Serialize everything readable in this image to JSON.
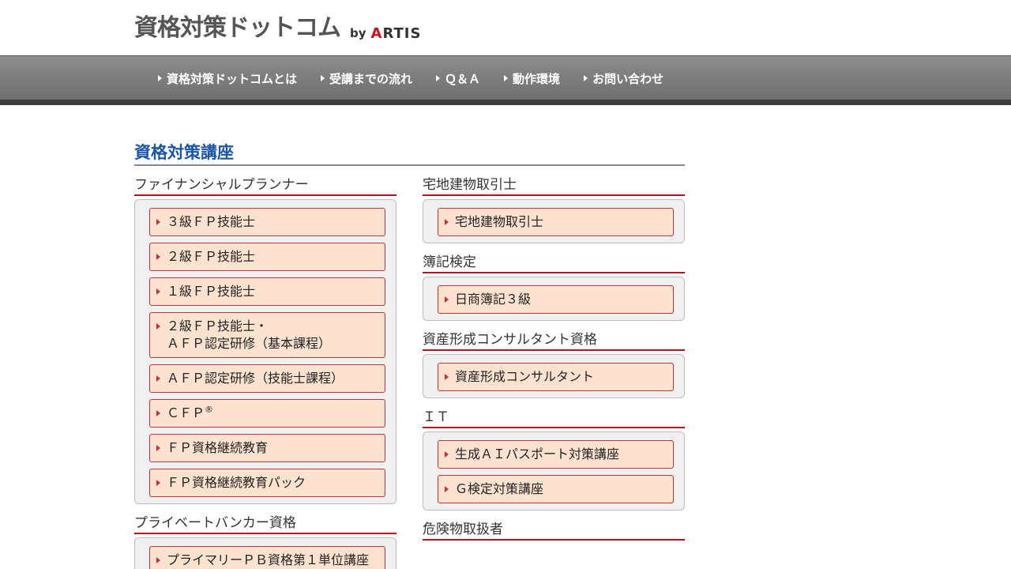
{
  "header": {
    "logo_main": "資格対策ドットコム",
    "logo_by": "by",
    "logo_brand_a": "A",
    "logo_brand_rest": "RTIS"
  },
  "nav": {
    "items": [
      {
        "label": "資格対策ドットコムとは"
      },
      {
        "label": "受講までの流れ"
      },
      {
        "label": "Ｑ＆Ａ"
      },
      {
        "label": "動作環境"
      },
      {
        "label": "お問い合わせ"
      }
    ]
  },
  "section": {
    "title": "資格対策講座"
  },
  "left_column": {
    "categories": [
      {
        "title": "ファイナンシャルプランナー",
        "courses": [
          {
            "line1": "３級ＦＰ技能士"
          },
          {
            "line1": "２級ＦＰ技能士"
          },
          {
            "line1": "１級ＦＰ技能士"
          },
          {
            "line1": "２級ＦＰ技能士・",
            "line2": "ＡＦＰ認定研修（基本課程）"
          },
          {
            "line1": "ＡＦＰ認定研修（技能士課程）"
          },
          {
            "line1": "ＣＦＰ",
            "sup": "®"
          },
          {
            "line1": "ＦＰ資格継続教育"
          },
          {
            "line1": "ＦＰ資格継続教育パック"
          }
        ]
      },
      {
        "title": "プライベートバンカー資格",
        "courses": [
          {
            "line1": "プライマリーＰＢ資格第１単位講座"
          }
        ]
      }
    ]
  },
  "right_column": {
    "categories": [
      {
        "title": "宅地建物取引士",
        "courses": [
          {
            "line1": "宅地建物取引士"
          }
        ]
      },
      {
        "title": "簿記検定",
        "courses": [
          {
            "line1": "日商簿記３級"
          }
        ]
      },
      {
        "title": "資産形成コンサルタント資格",
        "courses": [
          {
            "line1": "資産形成コンサルタント"
          }
        ]
      },
      {
        "title": "ＩＴ",
        "courses": [
          {
            "line1": "生成ＡＩパスポート対策講座"
          },
          {
            "line1": "Ｇ検定対策講座"
          }
        ]
      },
      {
        "title": "危険物取扱者",
        "courses": []
      }
    ]
  },
  "colors": {
    "accent_red": "#c2323b",
    "title_blue": "#1a56a8",
    "course_bg": "#fde3cf",
    "nav_bg": "#7f7f7f"
  }
}
